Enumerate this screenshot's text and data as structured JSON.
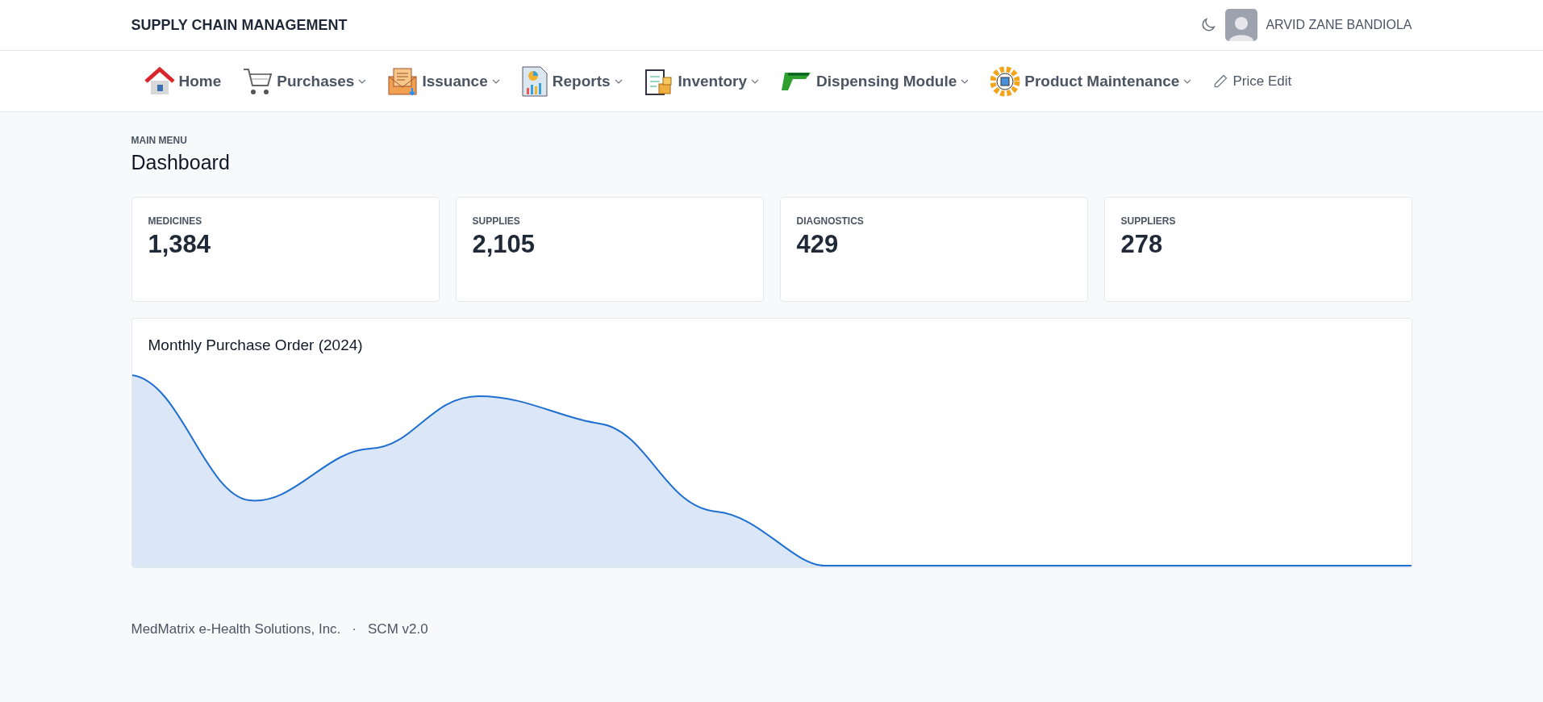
{
  "header": {
    "title": "SUPPLY CHAIN MANAGEMENT",
    "user": "ARVID ZANE BANDIOLA"
  },
  "nav": [
    {
      "label": "Home",
      "kind": "module",
      "dropdown": false
    },
    {
      "label": "Purchases",
      "kind": "module",
      "dropdown": true
    },
    {
      "label": "Issuance",
      "kind": "module",
      "dropdown": true
    },
    {
      "label": "Reports",
      "kind": "module",
      "dropdown": true
    },
    {
      "label": "Inventory",
      "kind": "module",
      "dropdown": true
    },
    {
      "label": "Dispensing Module",
      "kind": "module",
      "dropdown": true
    },
    {
      "label": "Product Maintenance",
      "kind": "module",
      "dropdown": true
    },
    {
      "label": "Price Edit",
      "kind": "link",
      "dropdown": false
    }
  ],
  "breadcrumb": "MAIN MENU",
  "page_title": "Dashboard",
  "stats": [
    {
      "label": "MEDICINES",
      "value": "1,384"
    },
    {
      "label": "SUPPLIES",
      "value": "2,105"
    },
    {
      "label": "DIAGNOSTICS",
      "value": "429"
    },
    {
      "label": "SUPPLIERS",
      "value": "278"
    }
  ],
  "chart": {
    "title": "Monthly Purchase Order (2024)"
  },
  "footer": {
    "company": "MedMatrix e-Health Solutions, Inc.",
    "separator": "·",
    "version": "SCM v2.0"
  }
}
